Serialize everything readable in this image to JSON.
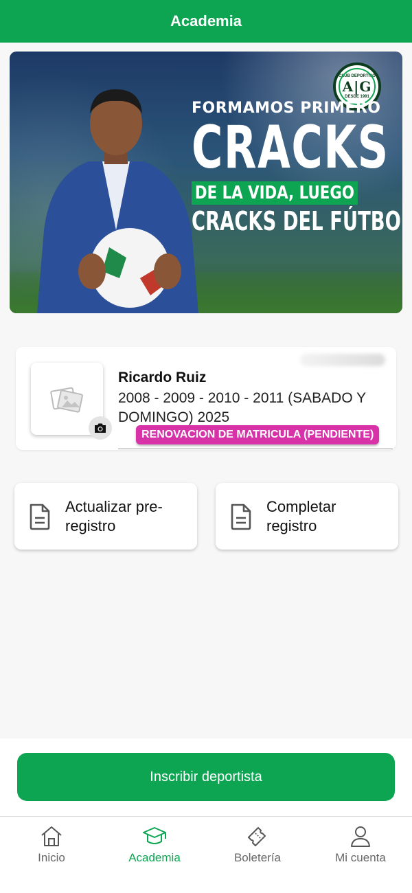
{
  "header": {
    "title": "Academia"
  },
  "banner": {
    "logo_monogram": "A|G",
    "logo_caption_top": "CLUB DEPORTIVO",
    "logo_caption_bottom": "DESDE 1991",
    "line1": "FORMAMOS PRIMERO",
    "line2": "CRACKS",
    "line3": "DE LA VIDA, LUEGO",
    "line4": "CRACKS DEL FÚTBOL"
  },
  "athlete": {
    "name": "Ricardo Ruiz",
    "category": "2008 - 2009 - 2010 - 2011 (SABADO Y DOMINGO) 2025",
    "status": "RENOVACION DE MATRICULA (PENDIENTE)",
    "status_color": "#d832a8"
  },
  "actions": [
    {
      "label": "Actualizar pre-registro",
      "icon": "document-icon"
    },
    {
      "label": "Completar registro",
      "icon": "document-icon"
    }
  ],
  "primary_button": {
    "label": "Inscribir deportista"
  },
  "tabs": [
    {
      "label": "Inicio",
      "icon": "home-icon",
      "active": false
    },
    {
      "label": "Academia",
      "icon": "graduation-cap-icon",
      "active": true
    },
    {
      "label": "Boletería",
      "icon": "ticket-icon",
      "active": false
    },
    {
      "label": "Mi cuenta",
      "icon": "user-icon",
      "active": false
    }
  ],
  "colors": {
    "brand": "#0ea552",
    "badge": "#d832a8"
  }
}
